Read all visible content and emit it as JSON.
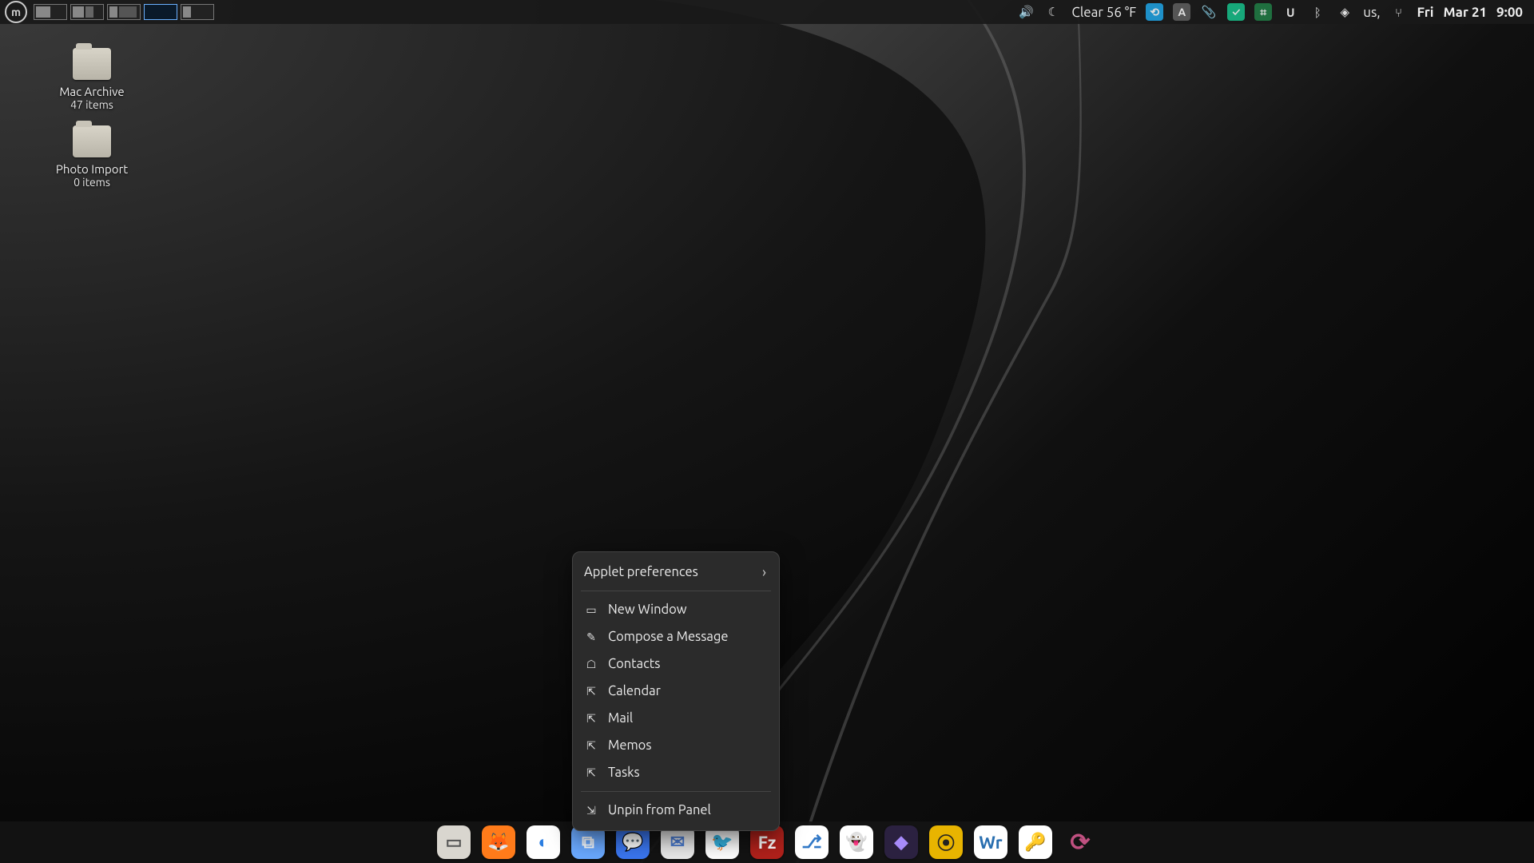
{
  "panel": {
    "weather": "Clear 56 °F",
    "keyboard_layout": "us,",
    "day": "Fri",
    "date": "Mar 21",
    "time": "9:00"
  },
  "desktop": {
    "icons": [
      {
        "name": "Mac Archive",
        "sub": "47 items"
      },
      {
        "name": "Photo Import",
        "sub": "0 items"
      }
    ]
  },
  "context_menu": {
    "header": "Applet preferences",
    "items": [
      "New Window",
      "Compose a Message",
      "Contacts",
      "Calendar",
      "Mail",
      "Memos",
      "Tasks"
    ],
    "footer": "Unpin from Panel"
  },
  "dock": {
    "apps": [
      {
        "name": "files",
        "bg": "#d9d6cf",
        "fg": "#555",
        "glyph": "▭"
      },
      {
        "name": "firefox",
        "bg": "#ff7b1a",
        "fg": "#fff",
        "glyph": "🦊"
      },
      {
        "name": "chromium",
        "bg": "#ffffff",
        "fg": "#2a7de1",
        "glyph": "◐"
      },
      {
        "name": "screenshot",
        "bg": "#6aa9ff",
        "fg": "#fff",
        "glyph": "⧉"
      },
      {
        "name": "signal",
        "bg": "#3a76f0",
        "fg": "#fff",
        "glyph": "💬"
      },
      {
        "name": "email",
        "bg": "#e9e9e9",
        "fg": "#4a7bd0",
        "glyph": "✉"
      },
      {
        "name": "thunderbird",
        "bg": "#ffffff",
        "fg": "#1f6fd0",
        "glyph": "🐦"
      },
      {
        "name": "filezilla",
        "bg": "#b1211b",
        "fg": "#fff",
        "glyph": "Fz"
      },
      {
        "name": "vscodium",
        "bg": "#ffffff",
        "fg": "#3178c6",
        "glyph": "⎇"
      },
      {
        "name": "ghostwriter",
        "bg": "#ffffff",
        "fg": "#222",
        "glyph": "👻"
      },
      {
        "name": "obsidian",
        "bg": "#2b2140",
        "fg": "#a78bfa",
        "glyph": "◆"
      },
      {
        "name": "rhythmbox",
        "bg": "#e8b400",
        "fg": "#222",
        "glyph": "⦿"
      },
      {
        "name": "writer",
        "bg": "#ffffff",
        "fg": "#2a6fb0",
        "glyph": "Wr"
      },
      {
        "name": "keepass",
        "bg": "#ffffff",
        "fg": "#2e8b2e",
        "glyph": "🔑"
      },
      {
        "name": "sync",
        "bg": "transparent",
        "fg": "#c05080",
        "glyph": "⟳"
      }
    ]
  }
}
